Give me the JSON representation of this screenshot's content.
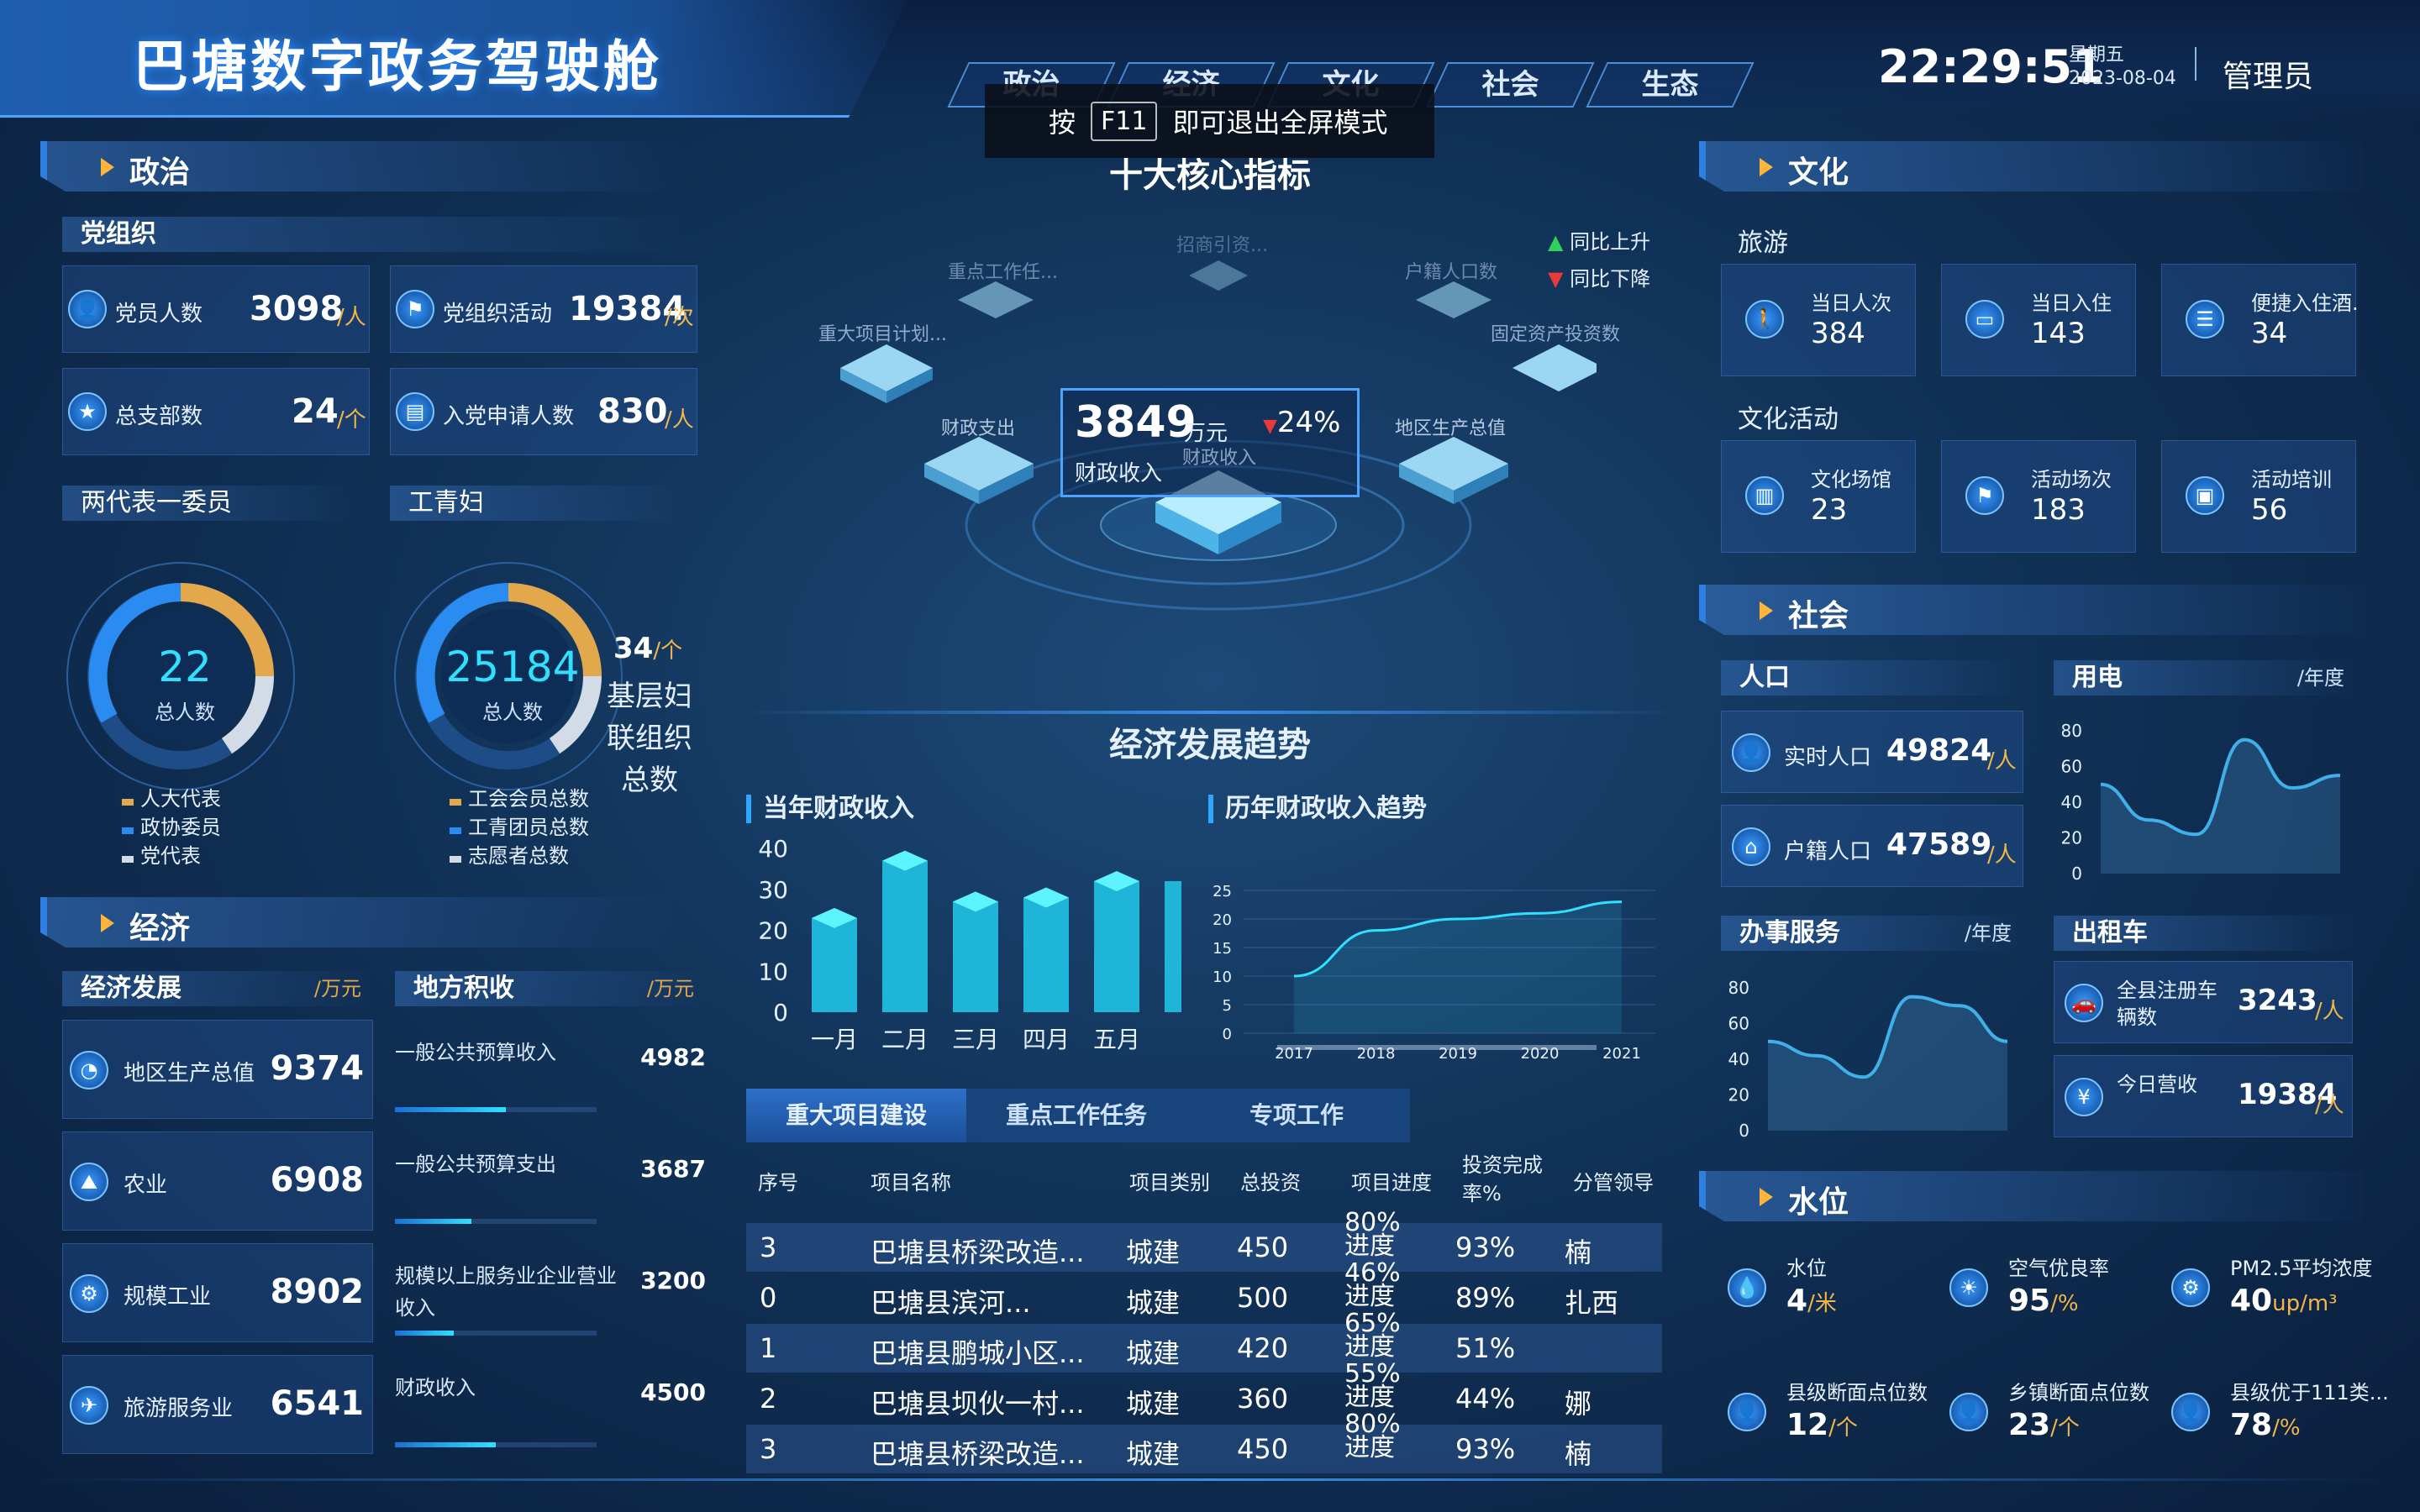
{
  "header": {
    "title": "巴塘数字政务驾驶舱",
    "tabs": [
      "政治",
      "经济",
      "文化",
      "社会",
      "生态"
    ],
    "time": "22:29:51",
    "weekday": "星期五",
    "date": "2023-08-04",
    "user": "管理员",
    "toast": {
      "before": "按",
      "key": "F11",
      "after": "即可退出全屏模式"
    }
  },
  "politics": {
    "section_title": "政治",
    "party_org": {
      "title": "党组织",
      "items": [
        {
          "label": "党员人数",
          "value": "3098",
          "unit": "/人",
          "icon": "user-icon"
        },
        {
          "label": "党组织活动",
          "value": "19384",
          "unit": "/次",
          "icon": "flag-icon"
        },
        {
          "label": "总支部数",
          "value": "24",
          "unit": "/个",
          "icon": "star-icon"
        },
        {
          "label": "入党申请人数",
          "value": "830",
          "unit": "/人",
          "icon": "doc-icon"
        }
      ]
    },
    "two_reps": {
      "title": "两代表一委员",
      "gauge_value": "22",
      "gauge_label": "总人数",
      "legend": [
        "人大代表",
        "政协委员",
        "党代表"
      ]
    },
    "workers": {
      "title": "工青妇",
      "gauge_value": "25184",
      "gauge_label": "总人数",
      "side_value": "34",
      "side_unit": "/个",
      "side_label_1": "基层妇",
      "side_label_2": "联组织",
      "side_label_3": "总数",
      "legend": [
        "工会会员总数",
        "工青团员总数",
        "志愿者总数"
      ]
    }
  },
  "economy": {
    "section_title": "经济",
    "dev_title": "经济发展",
    "dev_unit": "/万元",
    "fiscal_title": "地方积收",
    "fiscal_unit": "/万元",
    "dev_items": [
      {
        "label": "地区生产总值",
        "value": "9374",
        "icon": "pie-icon"
      },
      {
        "label": "农业",
        "value": "6908",
        "icon": "farm-icon"
      },
      {
        "label": "规模工业",
        "value": "8902",
        "icon": "factory-icon"
      },
      {
        "label": "旅游服务业",
        "value": "6541",
        "icon": "plane-icon"
      }
    ],
    "fiscal_items": [
      {
        "label": "一般公共预算收入",
        "value": "4982",
        "progress": 0.55
      },
      {
        "label": "一般公共预算支出",
        "value": "3687",
        "progress": 0.38
      },
      {
        "label": "规模以上服务业企业营业收入",
        "value": "3200",
        "progress": 0.29
      },
      {
        "label": "财政收入",
        "value": "4500",
        "progress": 0.5
      }
    ]
  },
  "core": {
    "title": "十大核心指标",
    "legend_up": "同比上升",
    "legend_down": "同比下降",
    "center_value": "3849",
    "center_unit": "万元",
    "center_pct": "24%",
    "center_label": "财政收入",
    "center_label_shadow": "财政收入",
    "labels": [
      "招商引资...",
      "重点工作任...",
      "户籍人口数",
      "重大项目计划...",
      "固定资产投资数",
      "财政支出",
      "地区生产总值"
    ]
  },
  "trend": {
    "title": "经济发展趋势",
    "bar_title": "当年财政收入",
    "line_title": "历年财政收入趋势",
    "chart_data": [
      {
        "type": "bar",
        "categories": [
          "一月",
          "二月",
          "三月",
          "四月",
          "五月"
        ],
        "values": [
          23,
          37,
          27,
          28,
          32
        ],
        "ylim": [
          0,
          40
        ],
        "yticks": [
          "40",
          "30",
          "20",
          "10",
          "0"
        ]
      },
      {
        "type": "line",
        "x": [
          "2017",
          "2018",
          "2019",
          "2020",
          "2021"
        ],
        "values": [
          10,
          18,
          20,
          21,
          23
        ],
        "ylim": [
          0,
          25
        ],
        "yticks": [
          "25",
          "20",
          "15",
          "10",
          "5",
          "0"
        ]
      }
    ]
  },
  "projects": {
    "tabs": [
      "重大项目建设",
      "重点工作任务",
      "专项工作"
    ],
    "columns": [
      "序号",
      "项目名称",
      "项目类别",
      "总投资",
      "项目进度",
      "投资完成率%",
      "分管领导"
    ],
    "rows": [
      {
        "no": "3",
        "name": "巴塘县桥梁改造...",
        "type": "城建",
        "total": "450",
        "progress": "80%进度",
        "rate": "93%",
        "leader": "楠"
      },
      {
        "no": "0",
        "name": "巴塘县滨河...",
        "type": "城建",
        "total": "500",
        "progress": "46%进度",
        "rate": "89%",
        "leader": "扎西"
      },
      {
        "no": "1",
        "name": "巴塘县鹏城小区...",
        "type": "城建",
        "total": "420",
        "progress": "65%进度",
        "rate": "51%",
        "leader": ""
      },
      {
        "no": "2",
        "name": "巴塘县坝伙一村...",
        "type": "城建",
        "total": "360",
        "progress": "55%进度",
        "rate": "44%",
        "leader": "娜"
      },
      {
        "no": "3",
        "name": "巴塘县桥梁改造...",
        "type": "城建",
        "total": "450",
        "progress": "80%进度",
        "rate": "93%",
        "leader": "楠"
      }
    ]
  },
  "culture": {
    "section_title": "文化",
    "tour_title": "旅游",
    "tour_items": [
      {
        "label": "当日人次",
        "value": "384",
        "icon": "walker-icon"
      },
      {
        "label": "当日入住",
        "value": "143",
        "icon": "bed-icon"
      },
      {
        "label": "便捷入住酒...",
        "value": "34",
        "icon": "list-icon"
      }
    ],
    "activity_title": "文化活动",
    "activity_items": [
      {
        "label": "文化场馆",
        "value": "23",
        "icon": "building-icon"
      },
      {
        "label": "活动场次",
        "value": "183",
        "icon": "flag-icon"
      },
      {
        "label": "活动培训",
        "value": "56",
        "icon": "screen-icon"
      }
    ]
  },
  "society": {
    "section_title": "社会",
    "pop_title": "人口",
    "pop_items": [
      {
        "label": "实时人口",
        "value": "49824",
        "unit": "/人",
        "icon": "user-icon"
      },
      {
        "label": "户籍人口",
        "value": "47589",
        "unit": "/人",
        "icon": "home-icon"
      }
    ],
    "power_title": "用电",
    "power_unit": "/年度",
    "service_title": "办事服务",
    "service_unit": "/年度",
    "taxi_title": "出租车",
    "taxi_items": [
      {
        "label": "全县注册车辆数",
        "value": "3243",
        "unit": "/人",
        "icon": "car-icon"
      },
      {
        "label": "今日营收",
        "value": "19384",
        "unit": "/人",
        "icon": "money-icon"
      }
    ],
    "chart_data": [
      {
        "type": "area",
        "name": "用电",
        "values": [
          50,
          30,
          22,
          75,
          48,
          55
        ],
        "ylim": [
          0,
          80
        ],
        "yticks": [
          "80",
          "60",
          "40",
          "20",
          "0"
        ]
      },
      {
        "type": "area",
        "name": "办事服务",
        "values": [
          50,
          42,
          30,
          75,
          70,
          50
        ],
        "ylim": [
          0,
          80
        ],
        "yticks": [
          "80",
          "60",
          "40",
          "20",
          "0"
        ]
      }
    ]
  },
  "water": {
    "section_title": "水位",
    "items": [
      {
        "label": "水位",
        "value": "4",
        "unit": "/米",
        "icon": "drop-icon"
      },
      {
        "label": "空气优良率",
        "value": "95",
        "unit": "/%",
        "icon": "sun-icon"
      },
      {
        "label": "PM2.5平均浓度",
        "value": "40",
        "unit": "up/m³",
        "icon": "factory-icon"
      },
      {
        "label": "县级断面点位数",
        "value": "12",
        "unit": "/个",
        "icon": "user-icon"
      },
      {
        "label": "乡镇断面点位数",
        "value": "23",
        "unit": "/个",
        "icon": "user-icon"
      },
      {
        "label": "县级优于111类...",
        "value": "78",
        "unit": "/%",
        "icon": "user-icon"
      }
    ]
  },
  "colors": {
    "accent": "#2fe0ff",
    "gold": "#f2b64a",
    "up": "#2fd15a",
    "down": "#e83a3a"
  }
}
